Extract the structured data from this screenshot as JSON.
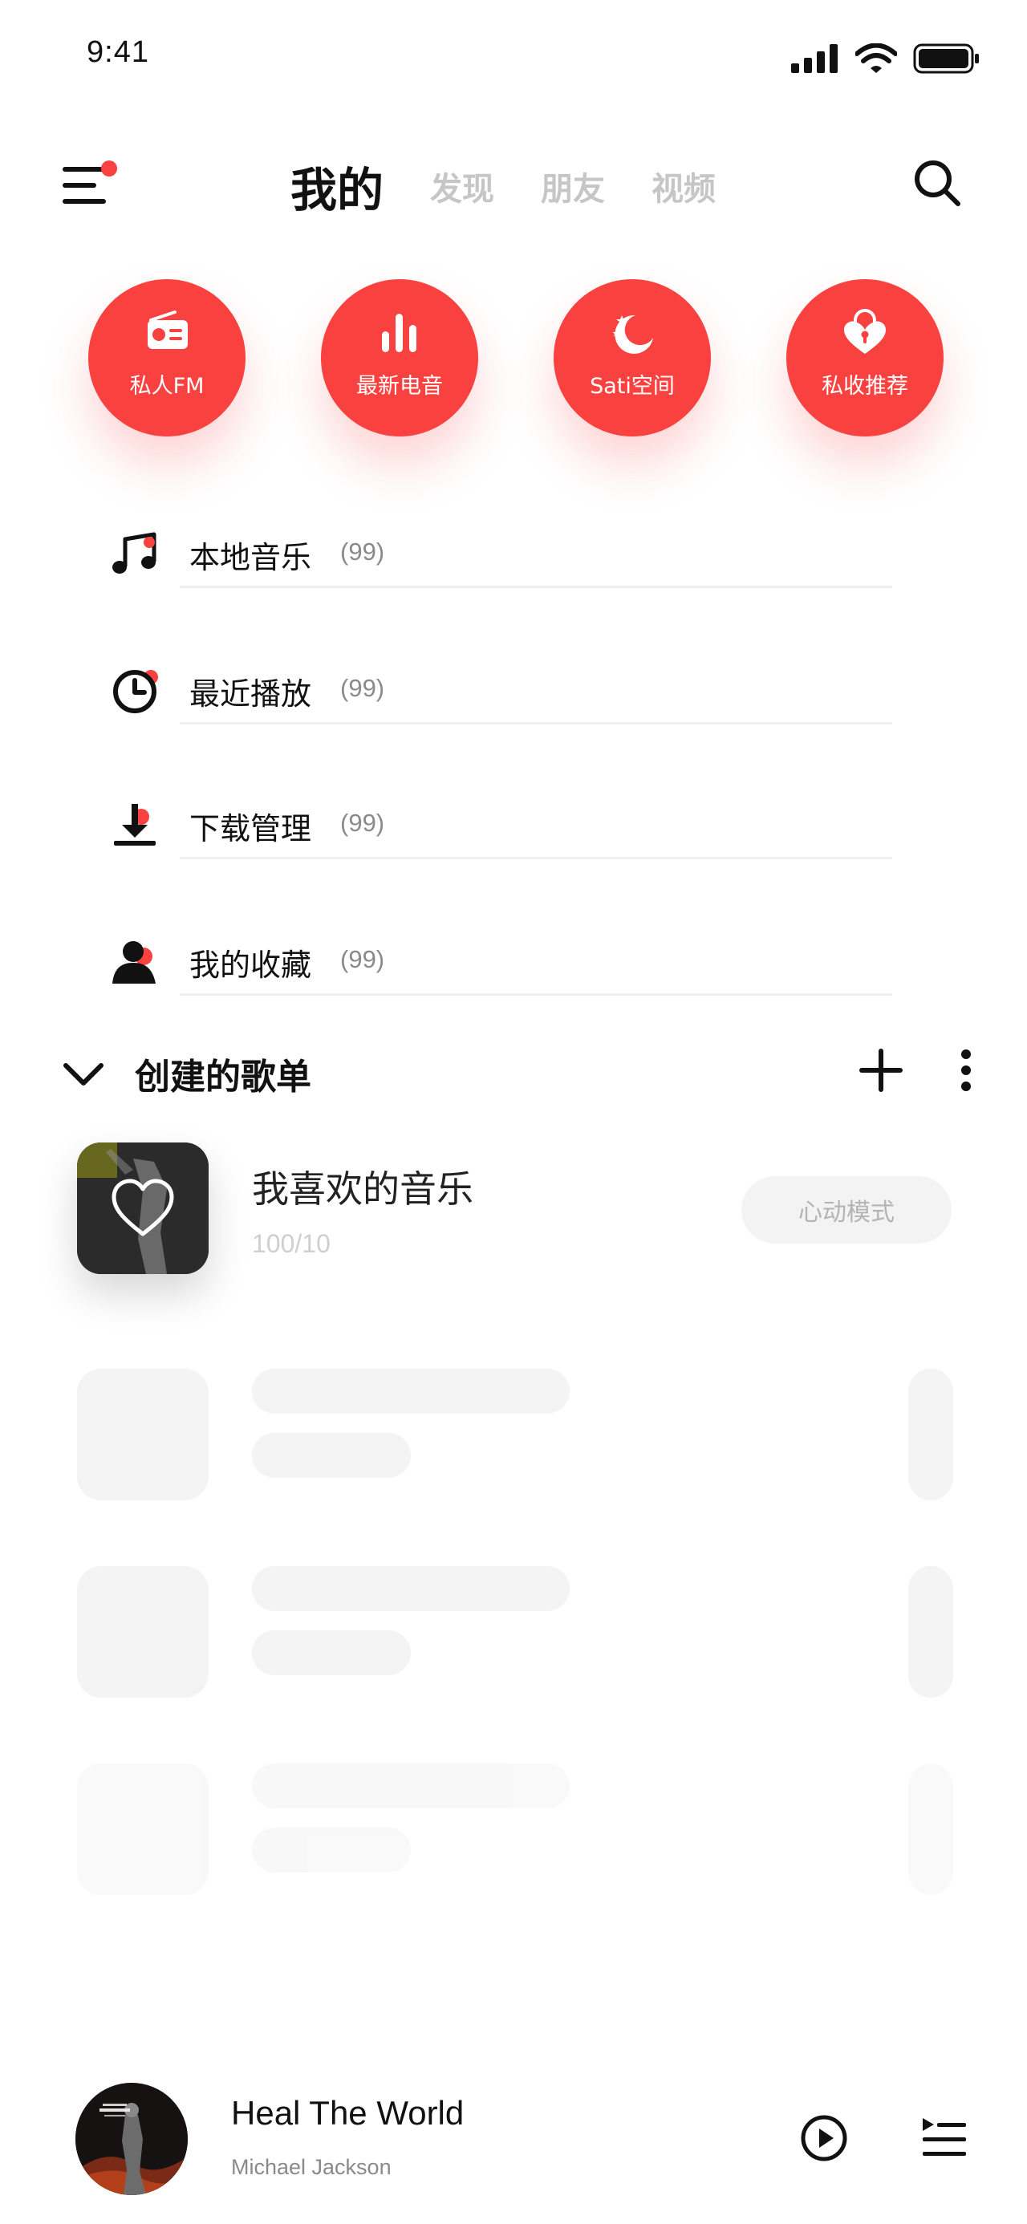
{
  "status_bar": {
    "time": "9:41"
  },
  "header": {
    "tabs": [
      {
        "label": "我的",
        "active": true
      },
      {
        "label": "发现",
        "active": false
      },
      {
        "label": "朋友",
        "active": false
      },
      {
        "label": "视频",
        "active": false
      }
    ],
    "menu_icon": "menu-icon",
    "search_icon": "search-icon"
  },
  "quick_actions": [
    {
      "label": "私人FM",
      "icon": "radio-icon"
    },
    {
      "label": "最新电音",
      "icon": "bars-icon"
    },
    {
      "label": "Sati空间",
      "icon": "moon-icon"
    },
    {
      "label": "私收推荐",
      "icon": "heart-lock-icon"
    }
  ],
  "library": [
    {
      "label": "本地音乐",
      "count": "(99)",
      "icon": "music-note-icon"
    },
    {
      "label": "最近播放",
      "count": "(99)",
      "icon": "clock-icon"
    },
    {
      "label": "下载管理",
      "count": "(99)",
      "icon": "download-icon"
    },
    {
      "label": "我的收藏",
      "count": "(99)",
      "icon": "user-icon"
    }
  ],
  "playlists_section": {
    "title": "创建的歌单",
    "items": [
      {
        "title": "我喜欢的音乐",
        "count": "100/10",
        "mode_label": "心动模式"
      }
    ]
  },
  "now_playing": {
    "title": "Heal The World",
    "artist": "Michael Jackson"
  },
  "colors": {
    "accent": "#f9413f",
    "text": "#111111",
    "muted": "#8a8a8a",
    "skeleton": "#f4f4f4"
  }
}
